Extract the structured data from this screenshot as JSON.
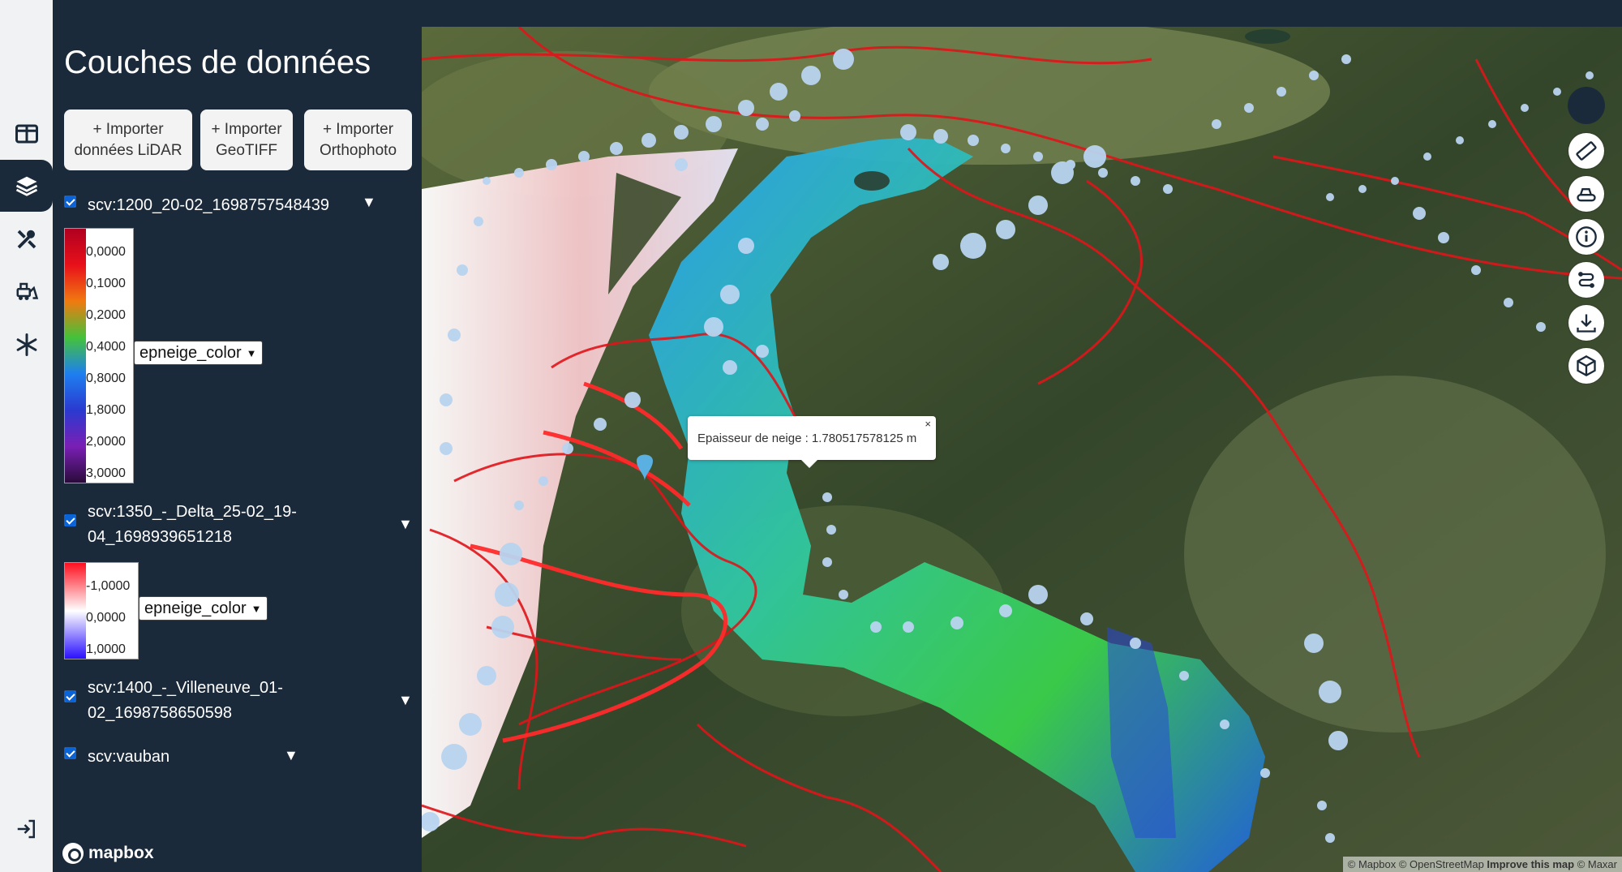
{
  "sidebar": {
    "items": [
      {
        "name": "table-icon",
        "active": false
      },
      {
        "name": "layers-icon",
        "active": true
      },
      {
        "name": "tools-icon",
        "active": false
      },
      {
        "name": "snowplow-icon",
        "active": false
      },
      {
        "name": "snowflake-icon",
        "active": false
      }
    ],
    "bottom_icon": "login-icon"
  },
  "panel": {
    "title": "Couches de données",
    "buttons": [
      {
        "label": "+ Importer données LiDAR"
      },
      {
        "label": "+ Importer GeoTIFF"
      },
      {
        "label": "+ Importer Orthophoto"
      }
    ],
    "layers": [
      {
        "name": "scv:1200_20-02_1698757548439",
        "checked": true,
        "legend": {
          "ticks": [
            "0,0000",
            "0,1000",
            "0,2000",
            "0,4000",
            "0,8000",
            "1,8000",
            "2,0000",
            "3,0000"
          ],
          "colors": [
            "#b00020",
            "#e8101a",
            "#f07a10",
            "#44c23a",
            "#1e7ff0",
            "#2a3ad0",
            "#7a1fb5",
            "#2a0b3a"
          ],
          "selected": "epneige_color"
        }
      },
      {
        "name": "scv:1350_-_Delta_25-02_19-04_1698939651218",
        "checked": true,
        "legend": {
          "ticks": [
            "-1,0000",
            "0,0000",
            "1,0000"
          ],
          "colors": [
            "#ff1020",
            "#ffffff",
            "#2a10ff"
          ],
          "selected": "epneige_color"
        }
      },
      {
        "name": "scv:1400_-_Villeneuve_01-02_1698758650598",
        "checked": true
      },
      {
        "name": "scv:vauban",
        "checked": true
      }
    ],
    "caret": "▼",
    "logo_text": "mapbox"
  },
  "map": {
    "popup_text": "Epaisseur de neige : 1.780517578125 m",
    "popup_close": "×",
    "attribution": {
      "mapbox": "© Mapbox",
      "osm": "© OpenStreetMap",
      "improve": "Improve this map",
      "maxar": "© Maxar"
    },
    "tools": [
      "ruler-icon",
      "snowcat-icon",
      "info-icon",
      "route-icon",
      "download-icon",
      "cube-icon"
    ]
  }
}
